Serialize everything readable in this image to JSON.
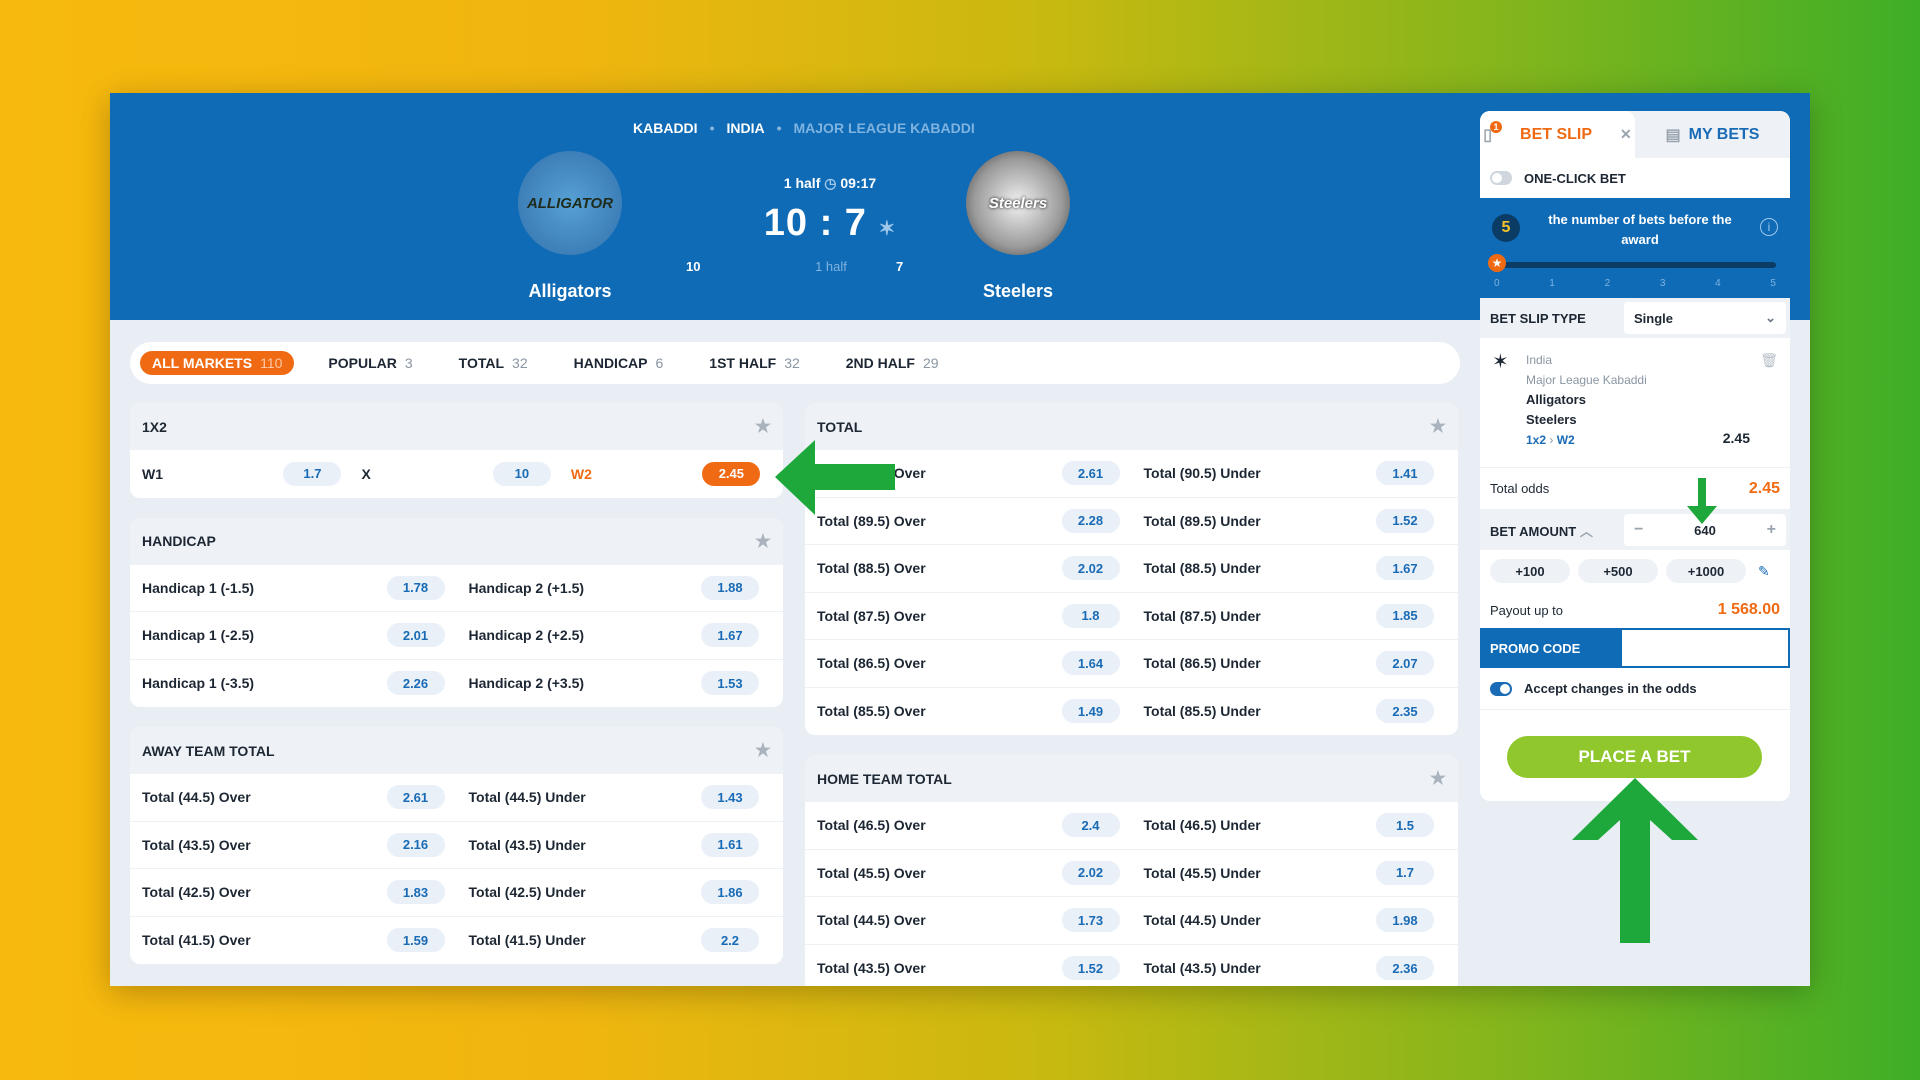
{
  "header": {
    "breadcrumb": [
      "KABADDI",
      "INDIA",
      "MAJOR LEAGUE KABADDI"
    ],
    "team1": {
      "name": "Alligators",
      "logo_text": "ALLIGATOR"
    },
    "team2": {
      "name": "Steelers",
      "logo_text": "Steelers"
    },
    "period": "1 half",
    "clock": "09:17",
    "score": "10 : 7",
    "sub_left": "10",
    "sub_mid": "1 half",
    "sub_right": "7"
  },
  "filters": [
    {
      "label": "ALL MARKETS",
      "count": "110",
      "active": true
    },
    {
      "label": "POPULAR",
      "count": "3"
    },
    {
      "label": "TOTAL",
      "count": "32"
    },
    {
      "label": "HANDICAP",
      "count": "6"
    },
    {
      "label": "1ST HALF",
      "count": "32"
    },
    {
      "label": "2ND HALF",
      "count": "29"
    }
  ],
  "markets": {
    "x12": {
      "title": "1X2",
      "w1": "W1",
      "w1_odd": "1.7",
      "x": "X",
      "x_odd": "10",
      "w2": "W2",
      "w2_odd": "2.45"
    },
    "handicap": {
      "title": "HANDICAP",
      "rows": [
        [
          "Handicap 1 (-1.5)",
          "1.78",
          "Handicap 2 (+1.5)",
          "1.88"
        ],
        [
          "Handicap 1 (-2.5)",
          "2.01",
          "Handicap 2 (+2.5)",
          "1.67"
        ],
        [
          "Handicap 1 (-3.5)",
          "2.26",
          "Handicap 2 (+3.5)",
          "1.53"
        ]
      ]
    },
    "away_total": {
      "title": "AWAY TEAM TOTAL",
      "rows": [
        [
          "Total (44.5) Over",
          "2.61",
          "Total (44.5) Under",
          "1.43"
        ],
        [
          "Total (43.5) Over",
          "2.16",
          "Total (43.5) Under",
          "1.61"
        ],
        [
          "Total (42.5) Over",
          "1.83",
          "Total (42.5) Under",
          "1.86"
        ],
        [
          "Total (41.5) Over",
          "1.59",
          "Total (41.5) Under",
          "2.2"
        ]
      ]
    },
    "total": {
      "title": "TOTAL",
      "rows": [
        [
          "Total (90.5) Over",
          "2.61",
          "Total (90.5) Under",
          "1.41"
        ],
        [
          "Total (89.5) Over",
          "2.28",
          "Total (89.5) Under",
          "1.52"
        ],
        [
          "Total (88.5) Over",
          "2.02",
          "Total (88.5) Under",
          "1.67"
        ],
        [
          "Total (87.5) Over",
          "1.8",
          "Total (87.5) Under",
          "1.85"
        ],
        [
          "Total (86.5) Over",
          "1.64",
          "Total (86.5) Under",
          "2.07"
        ],
        [
          "Total (85.5) Over",
          "1.49",
          "Total (85.5) Under",
          "2.35"
        ]
      ]
    },
    "home_total": {
      "title": "HOME TEAM TOTAL",
      "rows": [
        [
          "Total (46.5) Over",
          "2.4",
          "Total (46.5) Under",
          "1.5"
        ],
        [
          "Total (45.5) Over",
          "2.02",
          "Total (45.5) Under",
          "1.7"
        ],
        [
          "Total (44.5) Over",
          "1.73",
          "Total (44.5) Under",
          "1.98"
        ],
        [
          "Total (43.5) Over",
          "1.52",
          "Total (43.5) Under",
          "2.36"
        ]
      ]
    }
  },
  "slip": {
    "tab_slip": "BET SLIP",
    "tab_slip_badge": "1",
    "tab_mybets": "MY BETS",
    "one_click": "ONE-CLICK BET",
    "award_num": "5",
    "award_text": "the number of bets before the award",
    "award_ticks": [
      "0",
      "1",
      "2",
      "3",
      "4",
      "5"
    ],
    "type_label": "BET SLIP TYPE",
    "type_value": "Single",
    "coupon": {
      "country": "India",
      "league": "Major League Kabaddi",
      "team1": "Alligators",
      "team2": "Steelers",
      "market": "1x2",
      "outcome": "W2",
      "odd": "2.45"
    },
    "total_odds_label": "Total odds",
    "total_odds": "2.45",
    "amount_label": "BET AMOUNT",
    "amount": "640",
    "quick": [
      "+100",
      "+500",
      "+1000"
    ],
    "payout_label": "Payout up to",
    "payout": "1 568.00",
    "promo_label": "PROMO CODE",
    "accept_label": "Accept changes in the odds",
    "place_label": "PLACE A BET"
  },
  "colors": {
    "brand_blue": "#0f6bb6",
    "accent_orange": "#f06a13",
    "place_green": "#8fc72c",
    "annotation_arrow": "#1ea83c"
  }
}
